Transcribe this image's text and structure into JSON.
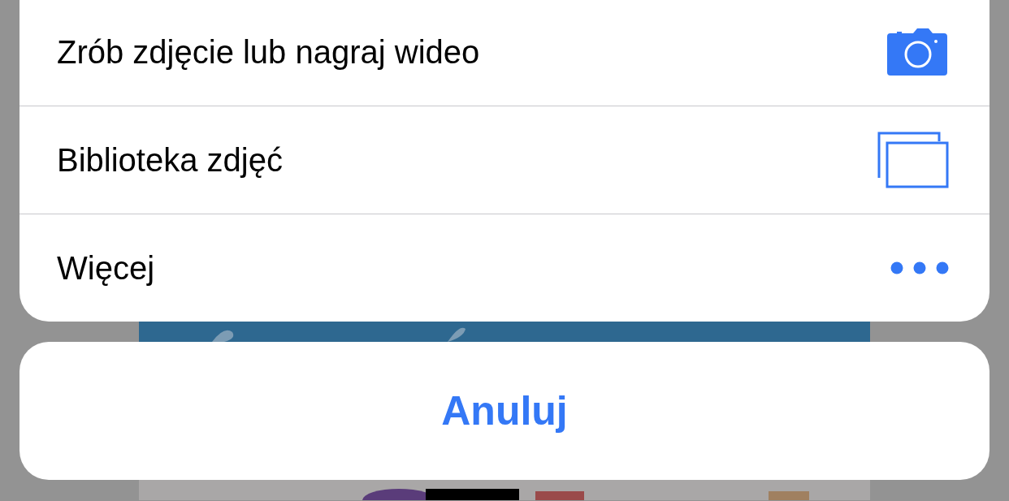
{
  "action_sheet": {
    "items": [
      {
        "label": "Zrób zdjęcie lub nagraj wideo",
        "kind": "camera"
      },
      {
        "label": "Biblioteka zdjęć",
        "kind": "library"
      },
      {
        "label": "Więcej",
        "kind": "more"
      }
    ]
  },
  "cancel_button": {
    "label": "Anuluj"
  }
}
